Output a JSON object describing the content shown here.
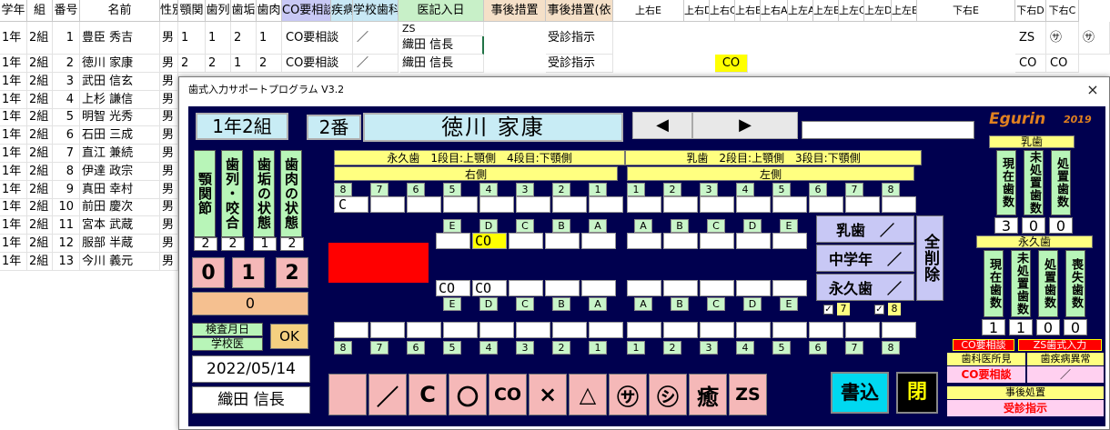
{
  "sheet": {
    "headers": [
      "学年",
      "組",
      "番号",
      "名前",
      "性別",
      "顎関",
      "歯列",
      "歯垢",
      "歯肉",
      "CO要相談",
      "疾病異常",
      "学校歯科医所見",
      "医記入日",
      "事後措置",
      "事後措置(依",
      "上右E",
      "上右D",
      "上右C",
      "上右B",
      "上右A",
      "上左A",
      "上左B",
      "上左C",
      "上左D",
      "上左E",
      "下右E",
      "下右D",
      "下右C"
    ],
    "rows": [
      {
        "grade": "1年",
        "cls": "2組",
        "no": "1",
        "name": "豊臣 秀吉",
        "sex": "男",
        "g": "1",
        "r": "1",
        "k": "2",
        "n": "1",
        "co": "CO要相談",
        "ill": "／",
        "doc1": "ZS",
        "doc2": "織田 信長",
        "care": "受診指示",
        "t1": "",
        "t2": "ZS",
        "t3": "㋚",
        "t4": "㋚"
      },
      {
        "grade": "1年",
        "cls": "2組",
        "no": "2",
        "name": "徳川 家康",
        "sex": "男",
        "g": "2",
        "r": "2",
        "k": "1",
        "n": "2",
        "co": "CO要相談",
        "ill": "／",
        "doc1": "",
        "doc2": "織田 信長",
        "care": "受診指示",
        "t1": "CO",
        "t2": "CO",
        "t3": "CO",
        "t4": ""
      },
      {
        "grade": "1年",
        "cls": "2組",
        "no": "3",
        "name": "武田 信玄",
        "sex": "男"
      },
      {
        "grade": "1年",
        "cls": "2組",
        "no": "4",
        "name": "上杉 謙信",
        "sex": "男"
      },
      {
        "grade": "1年",
        "cls": "2組",
        "no": "5",
        "name": "明智 光秀",
        "sex": "男"
      },
      {
        "grade": "1年",
        "cls": "2組",
        "no": "6",
        "name": "石田 三成",
        "sex": "男"
      },
      {
        "grade": "1年",
        "cls": "2組",
        "no": "7",
        "name": "直江 兼続",
        "sex": "男"
      },
      {
        "grade": "1年",
        "cls": "2組",
        "no": "8",
        "name": "伊達 政宗",
        "sex": "男"
      },
      {
        "grade": "1年",
        "cls": "2組",
        "no": "9",
        "name": "真田 幸村",
        "sex": "男"
      },
      {
        "grade": "1年",
        "cls": "2組",
        "no": "10",
        "name": "前田 慶次",
        "sex": "男"
      },
      {
        "grade": "1年",
        "cls": "2組",
        "no": "11",
        "name": "宮本 武蔵",
        "sex": "男"
      },
      {
        "grade": "1年",
        "cls": "2組",
        "no": "12",
        "name": "服部 半蔵",
        "sex": "男"
      },
      {
        "grade": "1年",
        "cls": "2組",
        "no": "13",
        "name": "今川 義元",
        "sex": "男"
      }
    ]
  },
  "dialog": {
    "title": "歯式入力サポートプログラム V3.2",
    "close": "×",
    "class_label": "1年2組",
    "number_label": "2番",
    "student_name": "徳川 家康",
    "prev_btn": "◀",
    "next_btn": "▶",
    "brand": "Egurin",
    "brand_year": "2019",
    "perm_header": "永久歯　1段目:上顎側　4段目:下顎側",
    "baby_header": "乳歯　2段目:上顎側　3段目:下顎側",
    "right_side": "右側",
    "left_side": "左側",
    "col_labels": [
      "顎関節",
      "歯列・咬合",
      "歯垢の状態",
      "歯肉の状態"
    ],
    "col_values": [
      "2",
      "2",
      "1",
      "2"
    ],
    "score_buttons": [
      "0",
      "1",
      "2"
    ],
    "score_result": "0",
    "exam_label1": "検査月日",
    "exam_label2": "学校医",
    "ok": "OK",
    "exam_date": "2022/05/14",
    "doctor": "織田 信長",
    "upper_perm_nums": [
      "8",
      "7",
      "6",
      "5",
      "4",
      "3",
      "2",
      "1",
      "1",
      "2",
      "3",
      "4",
      "5",
      "6",
      "7",
      "8"
    ],
    "lower_perm_nums": [
      "8",
      "7",
      "6",
      "5",
      "4",
      "3",
      "2",
      "1",
      "1",
      "2",
      "3",
      "4",
      "5",
      "6",
      "7",
      "8"
    ],
    "baby_letters": [
      "E",
      "D",
      "C",
      "B",
      "A",
      "A",
      "B",
      "C",
      "D",
      "E"
    ],
    "upper_perm_slots": [
      "C",
      "",
      "",
      "",
      "",
      "",
      "",
      "",
      "",
      "",
      "",
      "",
      "",
      "",
      "",
      ""
    ],
    "upper_baby_slots": [
      "",
      "CO",
      "",
      "",
      "",
      "",
      "",
      "",
      "",
      ""
    ],
    "lower_baby_slots": [
      "CO",
      "CO",
      "",
      "",
      "",
      "",
      "",
      "",
      "",
      ""
    ],
    "lower_perm_slots": [
      "",
      "",
      "",
      "",
      "",
      "",
      "",
      "",
      "",
      "",
      "",
      "",
      "",
      "",
      "",
      ""
    ],
    "side_buttons": [
      "乳歯　／",
      "中学年　／",
      "永久歯　／"
    ],
    "clear_all": "全削除",
    "checks": [
      {
        "label": "7",
        "checked": "✓"
      },
      {
        "label": "8",
        "checked": "✓"
      }
    ],
    "symbols": [
      "",
      "／",
      "C",
      "〇",
      "CO",
      "×",
      "△",
      "㋚",
      "㋛",
      "癒",
      "ZS"
    ],
    "write_btn": "書込",
    "close_btn": "閉",
    "baby_box": {
      "title": "乳歯",
      "cols": [
        "現在歯数",
        "未処置歯数",
        "処置歯数"
      ],
      "vals": [
        "3",
        "0",
        "0"
      ]
    },
    "perm_box": {
      "title": "永久歯",
      "cols": [
        "現在歯数",
        "未処置歯数",
        "処置歯数",
        "喪失歯数"
      ],
      "vals": [
        "1",
        "1",
        "0",
        "0"
      ]
    },
    "tag_co": "CO要相談",
    "tag_zs": "ZS歯式入力",
    "doc_findings_label": "歯科医所見",
    "illness_label": "歯疾病異常",
    "co_consult": "CO要相談",
    "slash": "／",
    "aftercare_label": "事後処置",
    "aftercare_value": "受診指示"
  },
  "colors": {
    "panel": "#00004f",
    "green": "#b8f5b8",
    "yellow": "#ffff80",
    "pink": "#f5b8b8",
    "red": "#ff0000",
    "lavender": "#c8c8f5",
    "brand": "#e08020"
  }
}
